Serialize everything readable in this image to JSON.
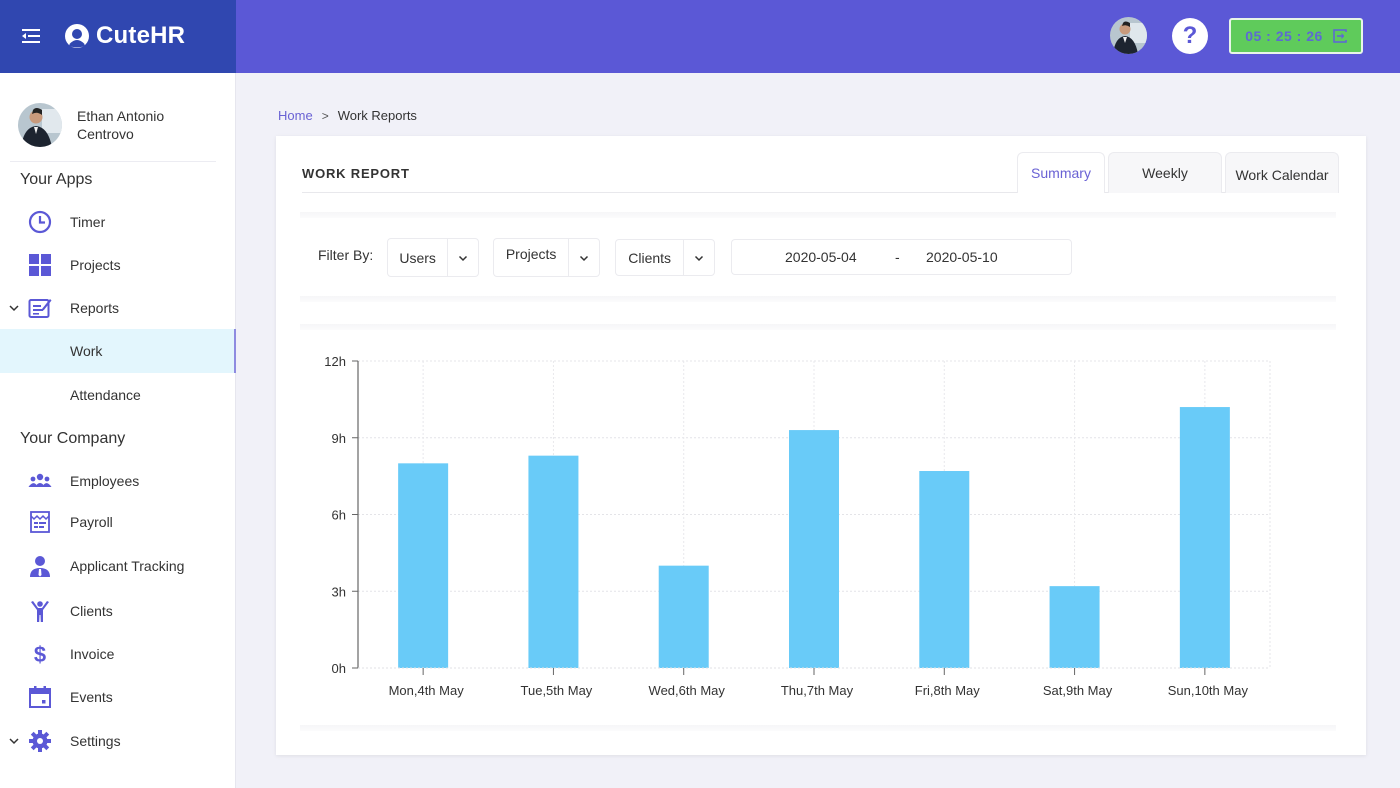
{
  "app": {
    "name": "CuteHR",
    "timer": "05 : 25 : 26",
    "help_label": "?",
    "colors": {
      "topbar": "#5b58d6",
      "brand_bg": "#3047b0",
      "accent": "#5b58d6",
      "timer_bg": "#5fcb5b",
      "bar": "#69cbf8",
      "active_nav_bg": "#e3f6fd"
    }
  },
  "user": {
    "name": "Ethan Antonio Centrovo"
  },
  "sidebar": {
    "apps_title": "Your Apps",
    "company_title": "Your Company",
    "apps": [
      {
        "label": "Timer",
        "icon": "clock-icon"
      },
      {
        "label": "Projects",
        "icon": "grid-icon"
      },
      {
        "label": "Reports",
        "icon": "report-edit-icon",
        "expanded": true
      },
      {
        "label": "Work",
        "active": true
      },
      {
        "label": "Attendance"
      }
    ],
    "company": [
      {
        "label": "Employees",
        "icon": "users-icon"
      },
      {
        "label": "Payroll",
        "icon": "payroll-icon"
      },
      {
        "label": "Applicant Tracking",
        "icon": "user-tie-icon"
      },
      {
        "label": "Clients",
        "icon": "person-arms-up-icon"
      },
      {
        "label": "Invoice",
        "icon": "dollar-icon"
      },
      {
        "label": "Events",
        "icon": "calendar-icon"
      },
      {
        "label": "Settings",
        "icon": "gear-icon",
        "expandable": true
      }
    ]
  },
  "breadcrumb": {
    "home": "Home",
    "separator": ">",
    "current": "Work Reports"
  },
  "report": {
    "title": "WORK REPORT",
    "tabs": [
      {
        "label": "Summary",
        "active": true
      },
      {
        "label": "Weekly"
      },
      {
        "label": "Work Calendar"
      }
    ],
    "filter": {
      "label": "Filter By:",
      "users": "Users",
      "projects": "Projects",
      "clients": "Clients",
      "date_from": "2020-05-04",
      "date_sep": "-",
      "date_to": "2020-05-10"
    }
  },
  "chart_data": {
    "type": "bar",
    "title": "",
    "xlabel": "",
    "ylabel": "",
    "categories": [
      "Mon,4th May",
      "Tue,5th May",
      "Wed,6th May",
      "Thu,7th May",
      "Fri,8th May",
      "Sat,9th May",
      "Sun,10th May"
    ],
    "values": [
      8.0,
      8.3,
      4.0,
      9.3,
      7.7,
      3.2,
      10.2
    ],
    "unit": "h",
    "ylim": [
      0,
      12
    ],
    "yticks": [
      0,
      3,
      6,
      9,
      12
    ],
    "ytick_labels": [
      "0h",
      "3h",
      "6h",
      "9h",
      "12h"
    ],
    "grid": true,
    "legend": "none"
  }
}
